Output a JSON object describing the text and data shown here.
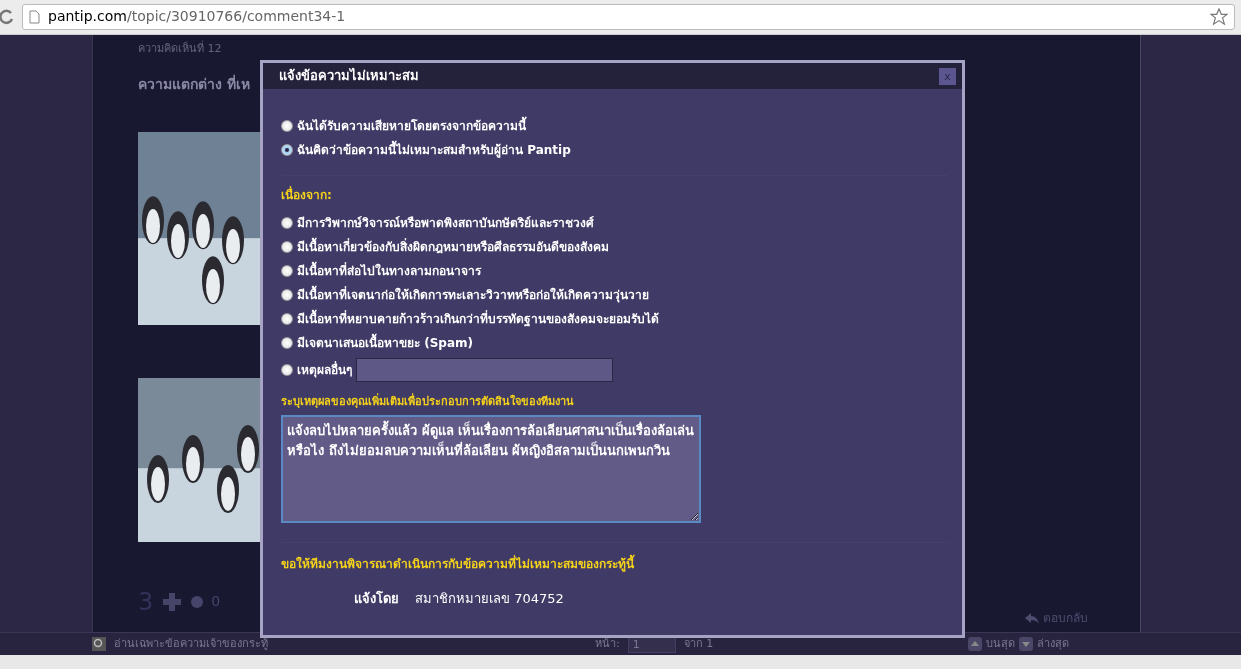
{
  "browser": {
    "url_host": "pantip.com",
    "url_path": "/topic/30910766/comment34-1"
  },
  "comment": {
    "number_label": "ความคิดเห็นที่ 12",
    "title": "ความแตกต่าง ที่เห",
    "votes": "3",
    "emotion_count": "0",
    "reply": "ตอบกลับ"
  },
  "bottom_bar": {
    "owner_only": "อ่านเฉพาะข้อความเจ้าของกระทู้",
    "page_label": "หน้า:",
    "page_value": "1",
    "page_total": "จาก 1",
    "to_top": "บนสุด",
    "to_bottom": "ล่างสุด"
  },
  "dialog": {
    "title": "แจ้งข้อความไม่เหมาะสม",
    "close": "x",
    "reporter_types": [
      {
        "label": "ฉันได้รับความเสียหายโดยตรงจากข้อความนี้",
        "selected": false
      },
      {
        "label": "ฉันคิดว่าข้อความนี้ไม่เหมาะสมสำหรับผู้อ่าน Pantip",
        "selected": true
      }
    ],
    "reasons_heading": "เนื่องจาก:",
    "reasons": [
      {
        "label": "มีการวิพากษ์วิจารณ์หรือพาดพิงสถาบันกษัตริย์และราชวงศ์",
        "selected": false
      },
      {
        "label": "มีเนื้อหาเกี่ยวข้องกับสิ่งผิดกฎหมายหรือศีลธรรมอันดีของสังคม",
        "selected": false
      },
      {
        "label": "มีเนื้อหาที่ส่อไปในทางลามกอนาจาร",
        "selected": false
      },
      {
        "label": "มีเนื้อหาที่เจตนาก่อให้เกิดการทะเลาะวิวาทหรือก่อให้เกิดความวุ่นวาย",
        "selected": false
      },
      {
        "label": "มีเนื้อหาที่หยาบคายก้าวร้าวเกินกว่าที่บรรทัดฐานของสังคมจะยอมรับได้",
        "selected": false
      },
      {
        "label": "มีเจตนาเสนอเนื้อหาขยะ (Spam)",
        "selected": false
      },
      {
        "label": "เหตุผลอื่นๆ",
        "selected": false,
        "kind": "other"
      }
    ],
    "details_label": "ระบุเหตุผลของคุณเพิ่มเติมเพื่อประกอบการตัดสินใจของทีมงาน",
    "details_value": "แจ้งลบไปหลายครั้งแล้ว ผ้ดูแล เห็นเรื่องการล้อเลียนศาสนาเป็นเรื่องล้อเล่นหรือไง ถึงไม่ยอมลบความเห็นที่ล้อเลียน ผ้หญิงอิสลามเป็นนกเพนกวิน",
    "request_heading": "ขอให้ทีมงานพิจารณาดำเนินการกับข้อความที่ไม่เหมาะสมของกระทู้นี้",
    "reported_by_label": "แจ้งโดย",
    "reported_by_value": "สมาชิกหมายเลข 704752"
  }
}
